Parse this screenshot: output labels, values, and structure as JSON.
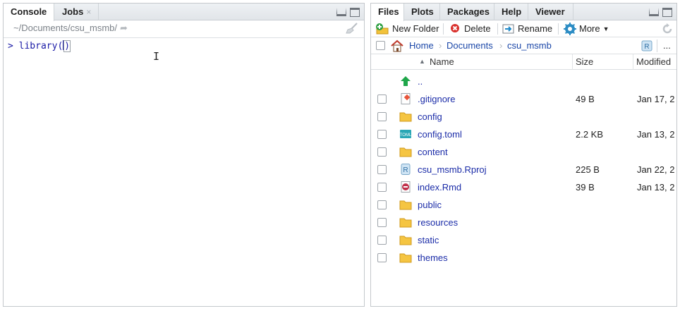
{
  "console_pane": {
    "tabs": [
      {
        "label": "Console"
      },
      {
        "label": "Jobs",
        "close": "×"
      }
    ],
    "path": "~/Documents/csu_msmb/",
    "prompt": ">",
    "command_before_cursor": "library(",
    "command_after_cursor": ")"
  },
  "files_pane": {
    "tabs": [
      {
        "label": "Files"
      },
      {
        "label": "Plots"
      },
      {
        "label": "Packages"
      },
      {
        "label": "Help"
      },
      {
        "label": "Viewer"
      }
    ],
    "toolbar": {
      "new_folder": "New Folder",
      "delete": "Delete",
      "rename": "Rename",
      "more": "More"
    },
    "breadcrumb": [
      "Home",
      "Documents",
      "csu_msmb"
    ],
    "overflow": "...",
    "columns": {
      "name": "Name",
      "size": "Size",
      "modified": "Modified"
    },
    "rows": [
      {
        "name": "..",
        "size": "",
        "modified": "",
        "icon": "up-arrow-icon",
        "checkbox": false
      },
      {
        "name": ".gitignore",
        "size": "49 B",
        "modified": "Jan 17, 2",
        "icon": "git-file-icon",
        "checkbox": true
      },
      {
        "name": "config",
        "size": "",
        "modified": "",
        "icon": "folder-icon",
        "checkbox": true
      },
      {
        "name": "config.toml",
        "size": "2.2 KB",
        "modified": "Jan 13, 2",
        "icon": "toml-file-icon",
        "checkbox": true
      },
      {
        "name": "content",
        "size": "",
        "modified": "",
        "icon": "folder-icon",
        "checkbox": true
      },
      {
        "name": "csu_msmb.Rproj",
        "size": "225 B",
        "modified": "Jan 22, 2",
        "icon": "rproj-file-icon",
        "checkbox": true
      },
      {
        "name": "index.Rmd",
        "size": "39 B",
        "modified": "Jan 13, 2",
        "icon": "rmd-file-icon",
        "checkbox": true
      },
      {
        "name": "public",
        "size": "",
        "modified": "",
        "icon": "folder-icon",
        "checkbox": true
      },
      {
        "name": "resources",
        "size": "",
        "modified": "",
        "icon": "folder-icon",
        "checkbox": true
      },
      {
        "name": "static",
        "size": "",
        "modified": "",
        "icon": "folder-icon",
        "checkbox": true
      },
      {
        "name": "themes",
        "size": "",
        "modified": "",
        "icon": "folder-icon",
        "checkbox": true
      }
    ]
  }
}
